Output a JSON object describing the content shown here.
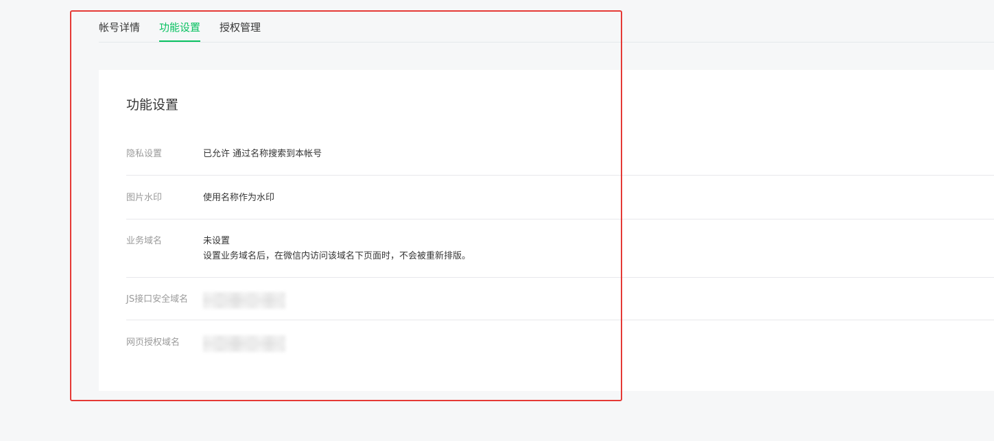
{
  "tabs": [
    {
      "label": "帐号详情",
      "active": false
    },
    {
      "label": "功能设置",
      "active": true
    },
    {
      "label": "授权管理",
      "active": false
    }
  ],
  "card": {
    "title": "功能设置",
    "rows": [
      {
        "label": "隐私设置",
        "value": "已允许 通过名称搜索到本帐号"
      },
      {
        "label": "图片水印",
        "value": "使用名称作为水印"
      },
      {
        "label": "业务域名",
        "value": "未设置",
        "description": "设置业务域名后，在微信内访问该域名下页面时，不会被重新排版。"
      },
      {
        "label": "JS接口安全域名",
        "value_redacted": true
      },
      {
        "label": "网页授权域名",
        "value_redacted": true
      }
    ]
  },
  "colors": {
    "accent": "#07c160",
    "highlight_frame": "#e53935",
    "background": "#f6f7f8",
    "label_gray": "#9a9a9a"
  }
}
